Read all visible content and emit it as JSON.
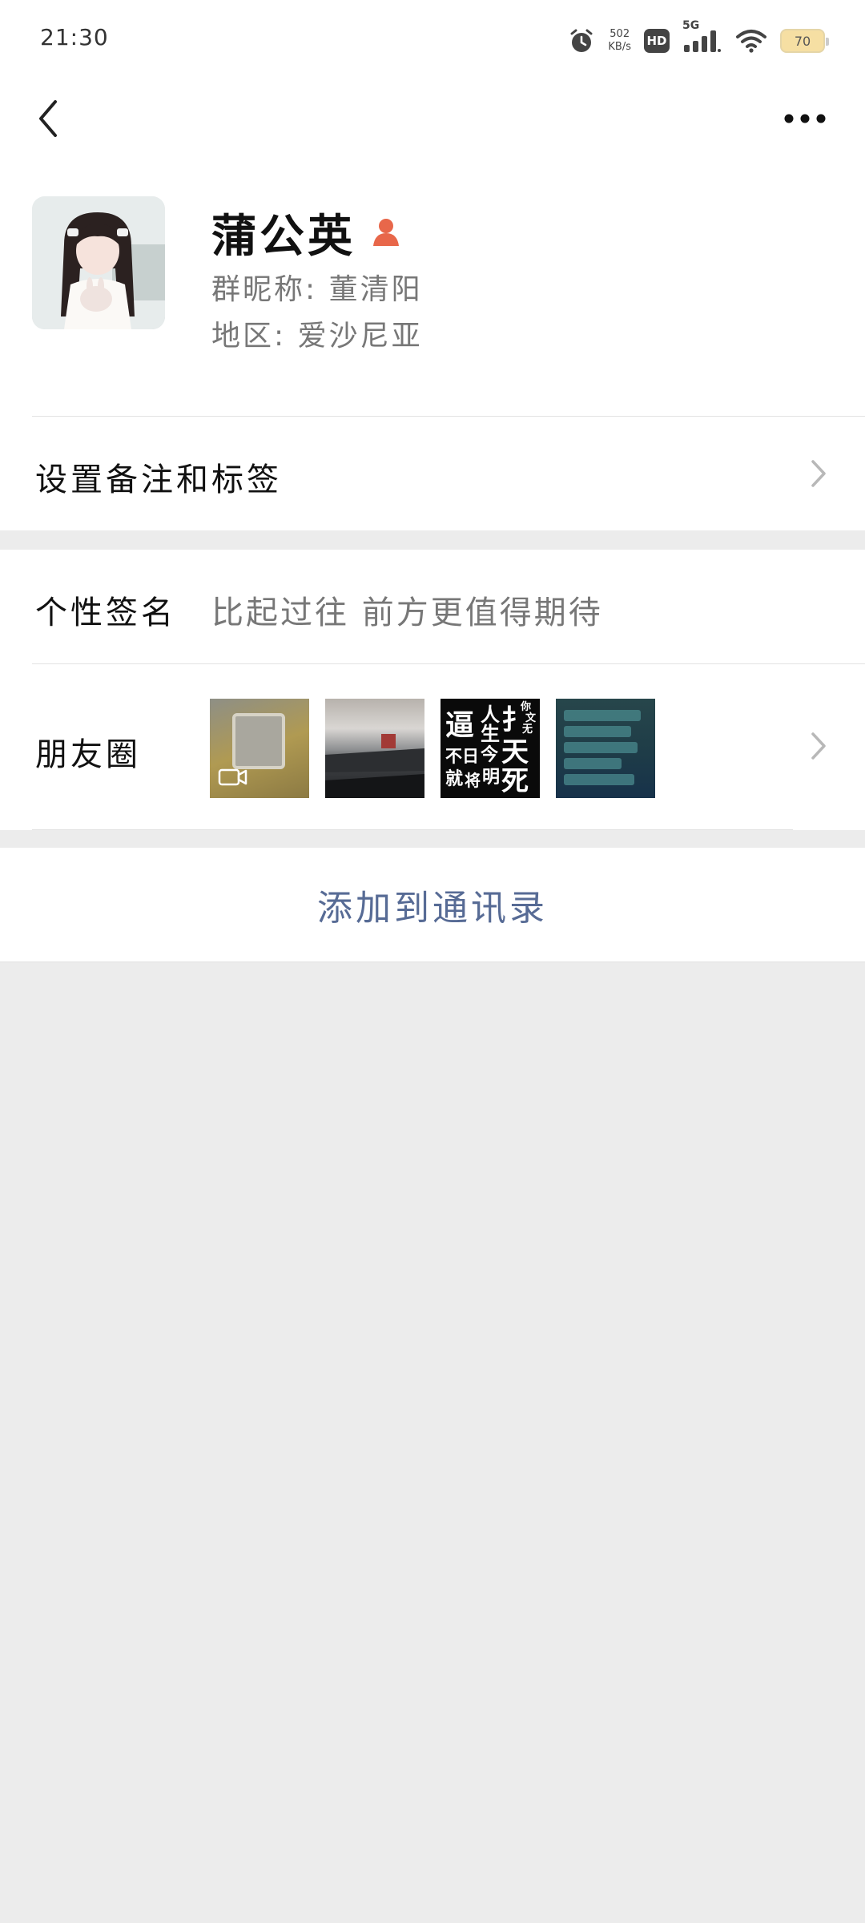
{
  "status_bar": {
    "time": "21:30",
    "net_speed_value": "502",
    "net_speed_unit": "KB/s",
    "hd_label": "HD",
    "network_label": "5G",
    "battery_level": "70",
    "icons": [
      "alarm-icon",
      "signal-icon",
      "wifi-icon",
      "battery-icon"
    ]
  },
  "nav": {
    "back_icon": "chevron-left-icon",
    "more_icon": "more-dots-icon"
  },
  "profile": {
    "name": "蒲公英",
    "gender_icon": "female-person-icon",
    "gender_color": "#e8674a",
    "group_nickname": "群昵称:  董清阳",
    "region": "地区:  爱沙尼亚"
  },
  "rows": {
    "remark_label": "设置备注和标签",
    "signature_label": "个性签名",
    "signature_value": "比起过往 前方更值得期待",
    "moments_label": "朋友圈",
    "moment_text": [
      "逼",
      "人",
      "生",
      "扌",
      "你",
      "文",
      "无",
      "不日",
      "今",
      "天",
      "死",
      "就",
      "将",
      "明"
    ]
  },
  "actions": {
    "add_contact": "添加到通讯录"
  },
  "colors": {
    "link": "#576b95",
    "background": "#ececec"
  }
}
